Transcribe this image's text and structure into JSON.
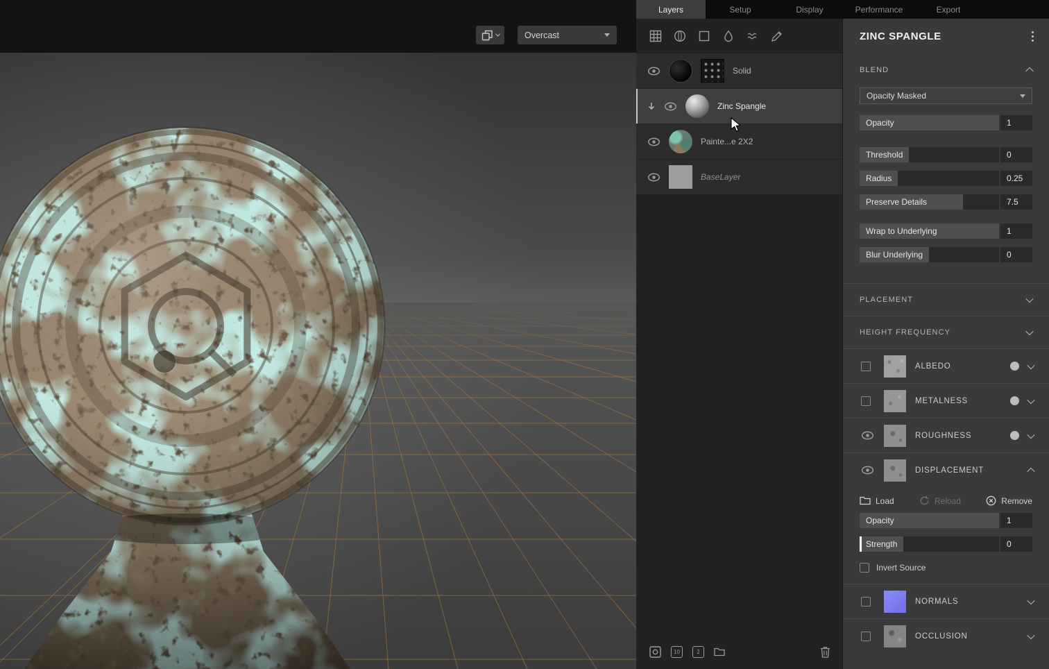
{
  "viewport": {
    "environment_value": "Overcast"
  },
  "tabs": [
    {
      "label": "Layers",
      "active": true
    },
    {
      "label": "Setup",
      "active": false
    },
    {
      "label": "Display",
      "active": false
    },
    {
      "label": "Performance",
      "active": false
    },
    {
      "label": "Export",
      "active": false
    }
  ],
  "layers_panel": {
    "layers": [
      {
        "name": "Solid",
        "selected": false
      },
      {
        "name": "Zinc Spangle",
        "selected": true
      },
      {
        "name": "Painte...e 2X2",
        "selected": false
      },
      {
        "name": "BaseLayer",
        "selected": false
      }
    ],
    "footer_badges": {
      "ten": "10",
      "two": "2"
    }
  },
  "properties": {
    "title": "ZINC SPANGLE",
    "blend": {
      "header": "BLEND",
      "mode": "Opacity Masked",
      "sliders": [
        {
          "label": "Opacity",
          "value": "1"
        },
        {
          "label": "Threshold",
          "value": "0"
        },
        {
          "label": "Radius",
          "value": "0.25"
        },
        {
          "label": "Preserve Details",
          "value": "7.5"
        },
        {
          "label": "Wrap to Underlying",
          "value": "1"
        },
        {
          "label": "Blur Underlying",
          "value": "0"
        }
      ]
    },
    "placement_header": "PLACEMENT",
    "height_frequency_header": "HEIGHT FREQUENCY",
    "channels": [
      {
        "label": "ALBEDO"
      },
      {
        "label": "METALNESS"
      },
      {
        "label": "ROUGHNESS"
      },
      {
        "label": "DISPLACEMENT"
      },
      {
        "label": "NORMALS"
      },
      {
        "label": "OCCLUSION"
      }
    ],
    "displacement": {
      "load": "Load",
      "reload": "Reload",
      "remove": "Remove",
      "opacity": {
        "label": "Opacity",
        "value": "1"
      },
      "strength": {
        "label": "Strength",
        "value": "0"
      },
      "invert_source": "Invert Source"
    }
  },
  "icons": {
    "layers_toolbar": [
      "grid-icon",
      "paint-sphere-icon",
      "solid-square-icon",
      "droplet-icon",
      "waves-icon",
      "brush-icon"
    ],
    "layers_footer": [
      "circle-box-icon",
      "badge-10-icon",
      "badge-2-icon",
      "folder-icon",
      "trash-icon"
    ],
    "misc": [
      "eye-icon",
      "cube-icon",
      "chevron-down-icon",
      "chevron-up-icon",
      "kebab-menu-icon",
      "folder-icon",
      "refresh-icon",
      "remove-circle-icon",
      "clip-arrow-down-icon"
    ]
  },
  "colors": {
    "grid_orange": "#aa7836",
    "patina_teal": "#8cd8c7",
    "normals_blue": "#7d7df0",
    "selection_bg": "#3f3f3f"
  }
}
